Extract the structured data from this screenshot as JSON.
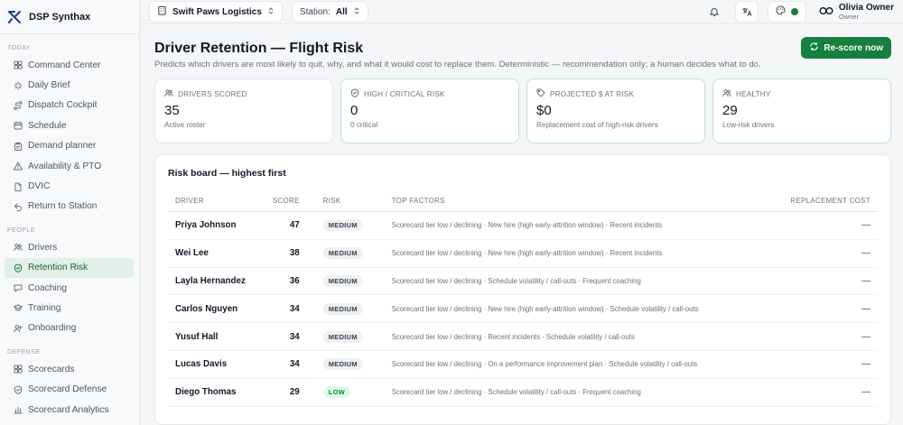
{
  "brand": {
    "name": "DSP Synthax"
  },
  "sidebar": {
    "sections": [
      {
        "label": "TODAY",
        "items": [
          {
            "label": "Command Center",
            "icon": "grid-icon"
          },
          {
            "label": "Daily Brief",
            "icon": "sparkle-icon"
          },
          {
            "label": "Dispatch Cockpit",
            "icon": "route-icon"
          },
          {
            "label": "Schedule",
            "icon": "calendar-icon"
          },
          {
            "label": "Demand planner",
            "icon": "clipboard-icon"
          },
          {
            "label": "Availability & PTO",
            "icon": "warning-icon"
          },
          {
            "label": "DVIC",
            "icon": "document-icon"
          },
          {
            "label": "Return to Station",
            "icon": "return-icon"
          }
        ]
      },
      {
        "label": "PEOPLE",
        "items": [
          {
            "label": "Drivers",
            "icon": "users-icon"
          },
          {
            "label": "Retention Risk",
            "icon": "shield-icon",
            "active": true
          },
          {
            "label": "Coaching",
            "icon": "chat-icon"
          },
          {
            "label": "Training",
            "icon": "graduation-cap-icon"
          },
          {
            "label": "Onboarding",
            "icon": "user-plus-icon"
          }
        ]
      },
      {
        "label": "DEFENSE",
        "items": [
          {
            "label": "Scorecards",
            "icon": "grid-icon"
          },
          {
            "label": "Scorecard Defense",
            "icon": "shield-icon"
          },
          {
            "label": "Scorecard Analytics",
            "icon": "chart-icon"
          }
        ]
      }
    ]
  },
  "topbar": {
    "org": "Swift Paws Logistics",
    "station_label": "Station:",
    "station_value": "All",
    "user_name": "Olivia Owner",
    "user_role": "Owner"
  },
  "page": {
    "title": "Driver Retention — Flight Risk",
    "subtitle": "Predicts which drivers are most likely to quit, why, and what it would cost to replace them. Deterministic — recommendation only; a human decides what to do.",
    "rescore_label": "Re-score now"
  },
  "cards": [
    {
      "label": "DRIVERS SCORED",
      "value": "35",
      "sub": "Active roster",
      "icon": "users-icon"
    },
    {
      "label": "HIGH / CRITICAL RISK",
      "value": "0",
      "sub": "0 critical",
      "icon": "shield-icon"
    },
    {
      "label": "PROJECTED $ AT RISK",
      "value": "$0",
      "sub": "Replacement cost of high-risk drivers",
      "icon": "tag-icon"
    },
    {
      "label": "HEALTHY",
      "value": "29",
      "sub": "Low-risk drivers",
      "icon": "users-icon"
    }
  ],
  "board": {
    "title": "Risk board — highest first",
    "columns": {
      "driver": "DRIVER",
      "score": "SCORE",
      "risk": "RISK",
      "factors": "TOP FACTORS",
      "cost": "REPLACEMENT COST"
    },
    "rows": [
      {
        "driver": "Priya Johnson",
        "score": "47",
        "risk": "MEDIUM",
        "factors": "Scorecard tier low / declining · New hire (high early-attrition window) · Recent incidents",
        "cost": "—"
      },
      {
        "driver": "Wei Lee",
        "score": "38",
        "risk": "MEDIUM",
        "factors": "Scorecard tier low / declining · New hire (high early-attrition window) · Recent incidents",
        "cost": "—"
      },
      {
        "driver": "Layla Hernandez",
        "score": "36",
        "risk": "MEDIUM",
        "factors": "Scorecard tier low / declining · Schedule volatility / call-outs · Frequent coaching",
        "cost": "—"
      },
      {
        "driver": "Carlos Nguyen",
        "score": "34",
        "risk": "MEDIUM",
        "factors": "Scorecard tier low / declining · New hire (high early-attrition window) · Schedule volatility / call-outs",
        "cost": "—"
      },
      {
        "driver": "Yusuf Hall",
        "score": "34",
        "risk": "MEDIUM",
        "factors": "Scorecard tier low / declining · Recent incidents · Schedule volatility / call-outs",
        "cost": "—"
      },
      {
        "driver": "Lucas Davis",
        "score": "34",
        "risk": "MEDIUM",
        "factors": "Scorecard tier low / declining · On a performance improvement plan · Schedule volatility / call-outs",
        "cost": "—"
      },
      {
        "driver": "Diego Thomas",
        "score": "29",
        "risk": "LOW",
        "factors": "Scorecard tier low / declining · Schedule volatility / call-outs · Frequent coaching",
        "cost": "—"
      }
    ]
  },
  "colors": {
    "accent": "#15803d",
    "accent_bg": "#e3efe8",
    "badge_low_bg": "#dcfce7"
  }
}
